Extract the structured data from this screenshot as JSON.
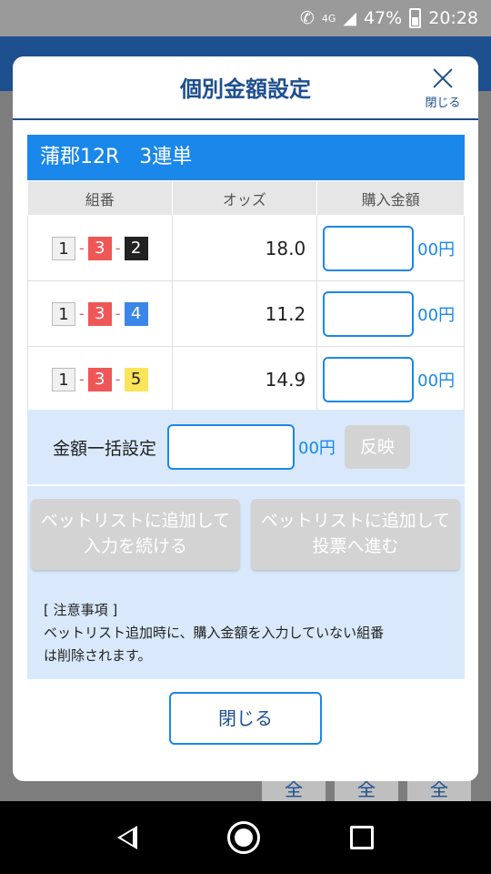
{
  "status": {
    "network": "4G",
    "battery": "47%",
    "time": "20:28"
  },
  "background": {
    "buttons": [
      "全",
      "全",
      "全"
    ]
  },
  "dialog": {
    "title": "個別金額設定",
    "close_label": "閉じる",
    "race_title": "蒲郡12R　3連単",
    "columns": [
      "組番",
      "オッズ",
      "購入金額"
    ],
    "rows": [
      {
        "combo": [
          "1",
          "3",
          "2"
        ],
        "odds": "18.0",
        "unit": "00円"
      },
      {
        "combo": [
          "1",
          "3",
          "4"
        ],
        "odds": "11.2",
        "unit": "00円"
      },
      {
        "combo": [
          "1",
          "3",
          "5"
        ],
        "odds": "14.9",
        "unit": "00円"
      }
    ],
    "bulk": {
      "label": "金額一括設定",
      "unit": "00円",
      "reflect": "反映"
    },
    "add_continue": [
      "ベットリストに追加して",
      "入力を続ける"
    ],
    "add_vote": [
      "ベットリストに追加して",
      "投票へ進む"
    ],
    "notes_title": "[ 注意事項 ]",
    "notes_line1": "ベットリスト追加時に、購入金額を入力していない組番",
    "notes_line2": "は削除されます。",
    "close_button": "閉じる"
  },
  "colors": {
    "accent": "#1a87ea",
    "navy": "#1e4f8f",
    "panel": "#d9e9fb",
    "disabled": "#d3d3d3"
  }
}
